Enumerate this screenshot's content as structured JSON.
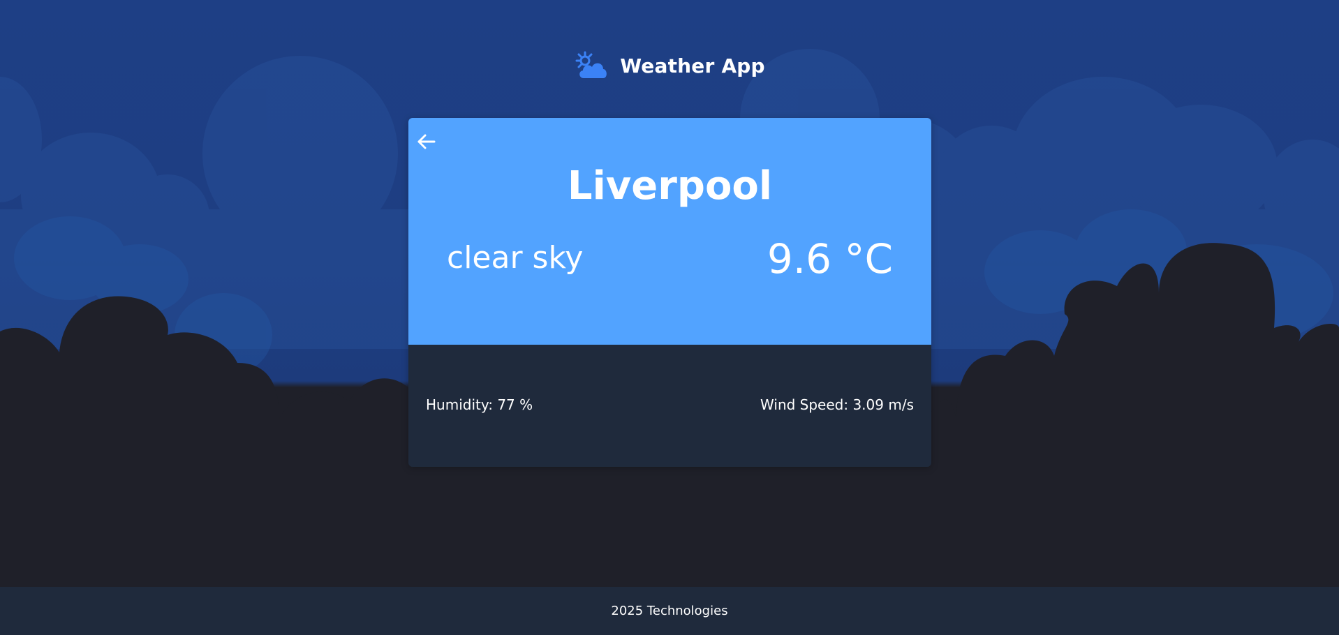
{
  "header": {
    "title": "Weather App",
    "icon": "sun-behind-cloud-icon"
  },
  "weather": {
    "city": "Liverpool",
    "description": "clear sky",
    "temperature": "9.6 °C",
    "humidity": "Humidity: 77 %",
    "wind_speed": "Wind Speed: 3.09 m/s"
  },
  "footer": {
    "text": "2025 Technologies"
  },
  "colors": {
    "card_top": "#52a3ff",
    "card_bottom": "#1f2a3c",
    "sky": "#1e3f85",
    "ground": "#1f2029",
    "icon_blue": "#3b82f6"
  }
}
